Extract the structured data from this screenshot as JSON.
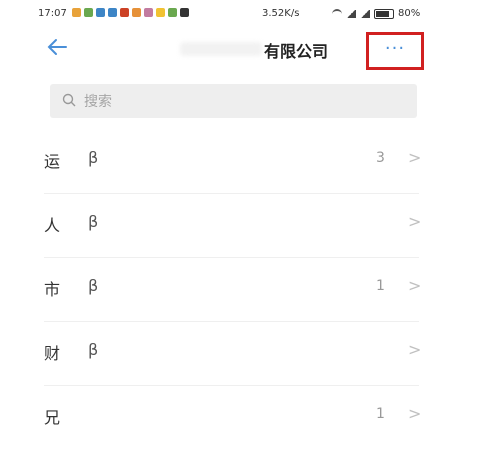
{
  "status_bar": {
    "time": "17:07",
    "network_speed": "3.52K/s",
    "battery": "80%"
  },
  "header": {
    "title": "有限公司",
    "more_label": "···"
  },
  "search": {
    "placeholder": "搜索"
  },
  "departments": [
    {
      "name": "运",
      "suffix": "β",
      "count": "3"
    },
    {
      "name": "人",
      "suffix": "β",
      "count": ""
    },
    {
      "name": "市",
      "suffix": "β",
      "count": "1"
    },
    {
      "name": "财",
      "suffix": "β",
      "count": ""
    },
    {
      "name": "兄",
      "suffix": "",
      "count": "1"
    }
  ],
  "colors": {
    "accent": "#4a8fd8",
    "highlight_box": "#d12020"
  }
}
